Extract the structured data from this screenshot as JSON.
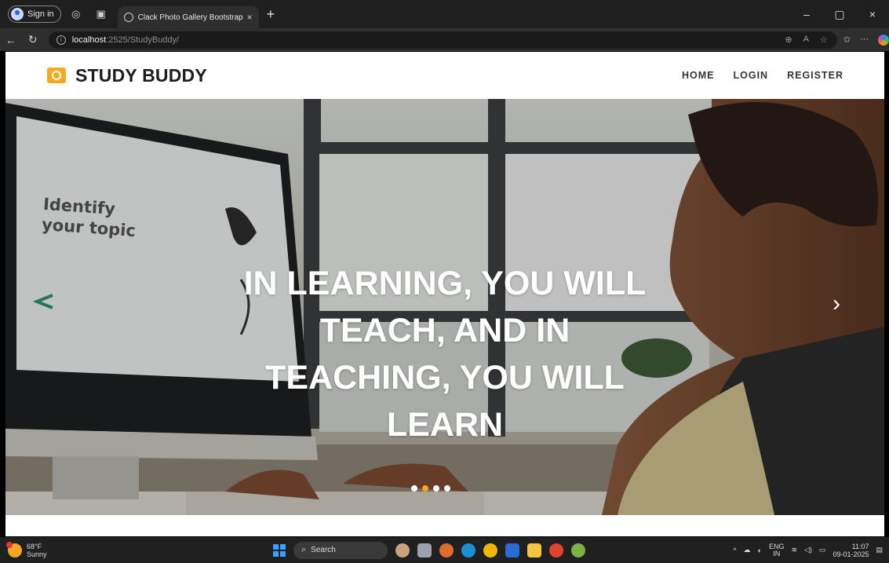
{
  "browser": {
    "sign_in_label": "Sign in",
    "tab_title": "Clack Photo Gallery Bootstrap Re",
    "tab_close": "×",
    "new_tab": "+",
    "url_host": "localhost",
    "url_path": ":2525/StudyBuddy/",
    "minimize": "–",
    "restore": "▢",
    "close": "×"
  },
  "site": {
    "brand_name": "STUDY BUDDY",
    "nav": {
      "home": "HOME",
      "login": "LOGIN",
      "register": "REGISTER"
    },
    "hero": {
      "line1": "IN LEARNING, YOU WILL",
      "line2": "TEACH, AND IN",
      "line3": "TEACHING, YOU WILL",
      "line4": "LEARN",
      "screen_title_1": "Identify",
      "screen_title_2": "your topic",
      "next_arrow": "›",
      "active_slide": 2,
      "slide_count": 4
    }
  },
  "taskbar": {
    "weather_temp": "68°F",
    "weather_desc": "Sunny",
    "search_label": "Search",
    "lang_1": "ENG",
    "lang_2": "IN",
    "time": "11:07",
    "date": "09-01-2025"
  },
  "colors": {
    "accent": "#f6a821",
    "brand_text": "#1c1c1c"
  }
}
